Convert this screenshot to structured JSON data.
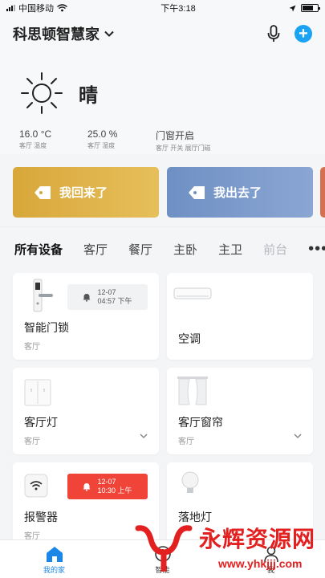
{
  "status_bar": {
    "carrier": "中国移动",
    "time": "下午3:18"
  },
  "header": {
    "home_name": "科思顿智慧家"
  },
  "weather": {
    "condition": "晴",
    "stats": [
      {
        "value": "16.0 °C",
        "label": "客厅 温度"
      },
      {
        "value": "25.0 %",
        "label": "客厅 湿度"
      },
      {
        "value": "门窗开启",
        "label": "客厅 开关 展厅门磁"
      }
    ]
  },
  "scenes": [
    {
      "label": "我回来了",
      "color": "#d8a73a"
    },
    {
      "label": "我出去了",
      "color": "#6f90c4"
    }
  ],
  "tabs": [
    "所有设备",
    "客厅",
    "餐厅",
    "主卧",
    "主卫",
    "前台"
  ],
  "devices": [
    {
      "name": "智能门锁",
      "room": "客厅",
      "badge_date": "12-07",
      "badge_time": "04:57 下午"
    },
    {
      "name": "空调",
      "room": ""
    },
    {
      "name": "客厅灯",
      "room": "客厅"
    },
    {
      "name": "客厅窗帘",
      "room": "客厅"
    },
    {
      "name": "报警器",
      "room": "客厅",
      "badge_date": "12-07",
      "badge_time": "10:30 上午"
    },
    {
      "name": "落地灯",
      "room": ""
    }
  ],
  "tabbar": [
    {
      "label": "我的家"
    },
    {
      "label": "智能"
    },
    {
      "label": "我"
    }
  ],
  "watermark": {
    "brand": "永辉资源网",
    "url": "www.yhkjjj.com"
  },
  "colors": {
    "accent": "#1aa3f5",
    "alarm": "#f04438",
    "active_tab": "#1a86e8"
  }
}
